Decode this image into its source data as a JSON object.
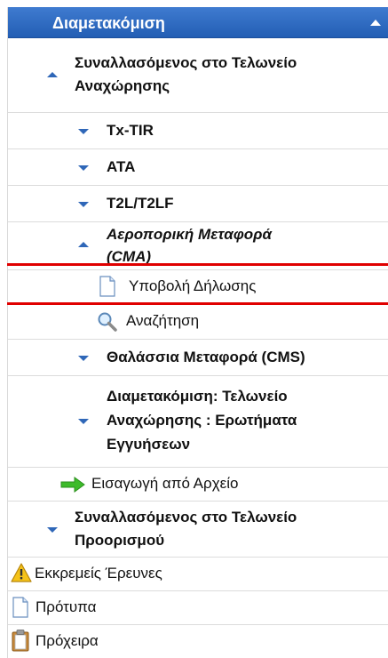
{
  "header": {
    "title": "Διαμετακόμιση"
  },
  "menu": [
    {
      "label_line1": "Συναλλασόμενος στο Τελωνείο",
      "label_line2": "Αναχώρησης"
    },
    {
      "label": "Tx-TIR"
    },
    {
      "label": "ATA"
    },
    {
      "label": "T2L/T2LF"
    },
    {
      "label_line1": "Αεροπορική Μεταφορά",
      "label_line2": "(CMA)"
    },
    {
      "label": "Υποβολή Δήλωσης",
      "icon": "document-icon"
    },
    {
      "label": "Αναζήτηση",
      "icon": "magnifier-icon"
    },
    {
      "label": "Θαλάσσια Μεταφορά (CMS)"
    },
    {
      "label_line1": "Διαμετακόμιση: Τελωνείο",
      "label_line2": "Αναχώρησης : Ερωτήματα",
      "label_line3": "Εγγυήσεων"
    },
    {
      "label": "Εισαγωγή από Αρχείο",
      "icon": "green-arrow-icon"
    },
    {
      "label_line1": "Συναλλασόμενος στο Τελωνείο",
      "label_line2": "Προορισμού"
    },
    {
      "label": "Εκκρεμείς Έρευνες",
      "icon": "warning-icon"
    },
    {
      "label": "Πρότυπα",
      "icon": "document-icon"
    },
    {
      "label": "Πρόχειρα",
      "icon": "clipboard-icon"
    }
  ],
  "colors": {
    "header": "#235eb4",
    "arrow": "#2f67b8",
    "highlight": "#e00000"
  }
}
